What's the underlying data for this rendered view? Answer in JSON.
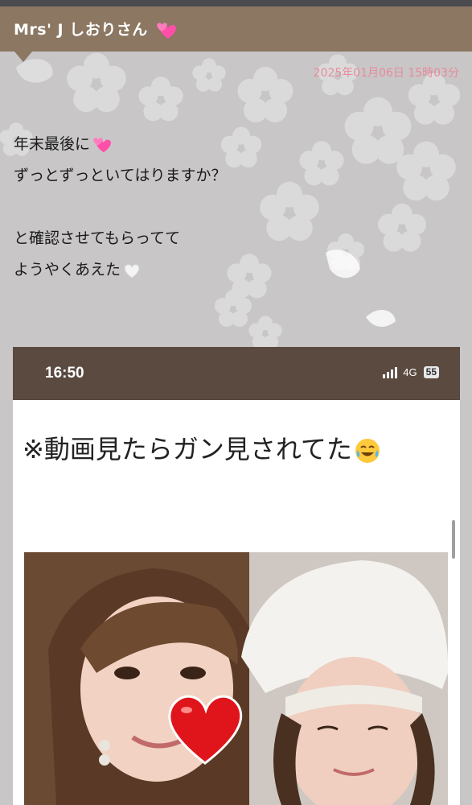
{
  "header": {
    "title": "Mrs' J しおりさん",
    "title_emoji": "two-hearts-icon"
  },
  "post": {
    "date": "2025年01月06日 15時03分",
    "lines": [
      "年末最後に",
      "ずっとずっといてはりますか？",
      "",
      "と確認させてもらってて",
      "ようやくあえた"
    ],
    "line1_emoji": "two-hearts-icon",
    "line5_emoji": "white-heart-icon"
  },
  "embedded_screenshot": {
    "time": "16:50",
    "network": "4G",
    "battery": "55",
    "heading": "※動画見たらガン見されてた",
    "heading_emoji": "tears-of-joy-icon",
    "photo_sticker": "red-heart-icon"
  },
  "colors": {
    "header_bg": "#8b7762",
    "date_color": "#e88a9a",
    "page_bg": "#c8c6c7",
    "status_bar_bg": "#5a4a40"
  }
}
